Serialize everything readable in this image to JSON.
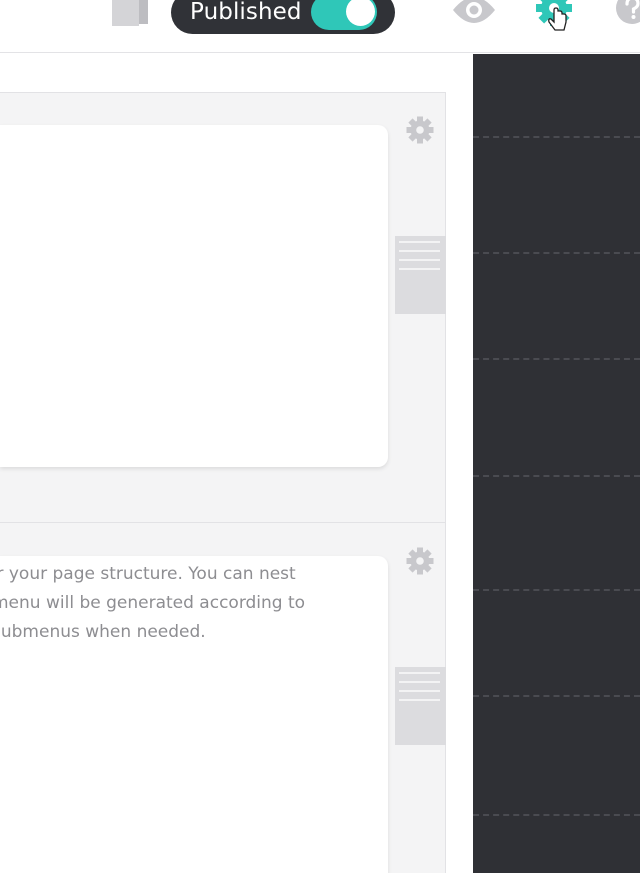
{
  "toolbar": {
    "publish_toggle": {
      "label": "Published",
      "state": "on"
    },
    "icons": {
      "page": "page-icon",
      "preview": "eye-icon",
      "settings": "gear-icon",
      "help": "help-icon"
    }
  },
  "blocks": [
    {
      "settings_icon": "gear-icon",
      "drag_handle": "drag-handle-icon",
      "text_lines": []
    },
    {
      "settings_icon": "gear-icon",
      "drag_handle": "drag-handle-icon",
      "text_lines": [
        "er your page structure. You can nest",
        "menu will be generated according to",
        "submenus when needed."
      ]
    }
  ],
  "colors": {
    "accent": "#2fc7b8",
    "toggle_bg": "#303237",
    "panel_bg": "#2f3035",
    "text_muted": "#8d8d91",
    "icon_gray": "#c8c8cc"
  }
}
